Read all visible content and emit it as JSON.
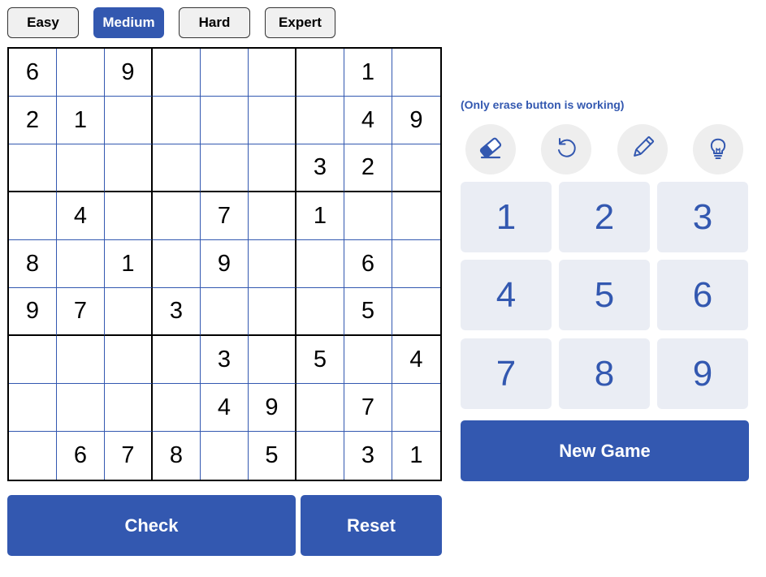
{
  "difficulty": {
    "options": [
      "Easy",
      "Medium",
      "Hard",
      "Expert"
    ],
    "selected": "Medium"
  },
  "board": [
    [
      "6",
      "",
      "9",
      "",
      "",
      "",
      "",
      "1",
      ""
    ],
    [
      "2",
      "1",
      "",
      "",
      "",
      "",
      "",
      "4",
      "9"
    ],
    [
      "",
      "",
      "",
      "",
      "",
      "",
      "3",
      "2",
      ""
    ],
    [
      "",
      "4",
      "",
      "",
      "7",
      "",
      "1",
      "",
      ""
    ],
    [
      "8",
      "",
      "1",
      "",
      "9",
      "",
      "",
      "6",
      ""
    ],
    [
      "9",
      "7",
      "",
      "3",
      "",
      "",
      "",
      "5",
      ""
    ],
    [
      "",
      "",
      "",
      "",
      "3",
      "",
      "5",
      "",
      "4"
    ],
    [
      "",
      "",
      "",
      "",
      "4",
      "9",
      "",
      "7",
      ""
    ],
    [
      "",
      "6",
      "7",
      "8",
      "",
      "5",
      "",
      "3",
      "1"
    ]
  ],
  "actions": {
    "check_label": "Check",
    "reset_label": "Reset",
    "new_game_label": "New Game"
  },
  "note": "(Only erase button is working)",
  "tools": [
    "eraser-icon",
    "undo-icon",
    "pencil-icon",
    "hint-bulb-icon"
  ],
  "numpad": [
    "1",
    "2",
    "3",
    "4",
    "5",
    "6",
    "7",
    "8",
    "9"
  ],
  "colors": {
    "accent": "#3358b0",
    "key_bg": "#eaedf4",
    "tool_bg": "#eeeeee",
    "inactive_btn_bg": "#f0f0f0"
  }
}
